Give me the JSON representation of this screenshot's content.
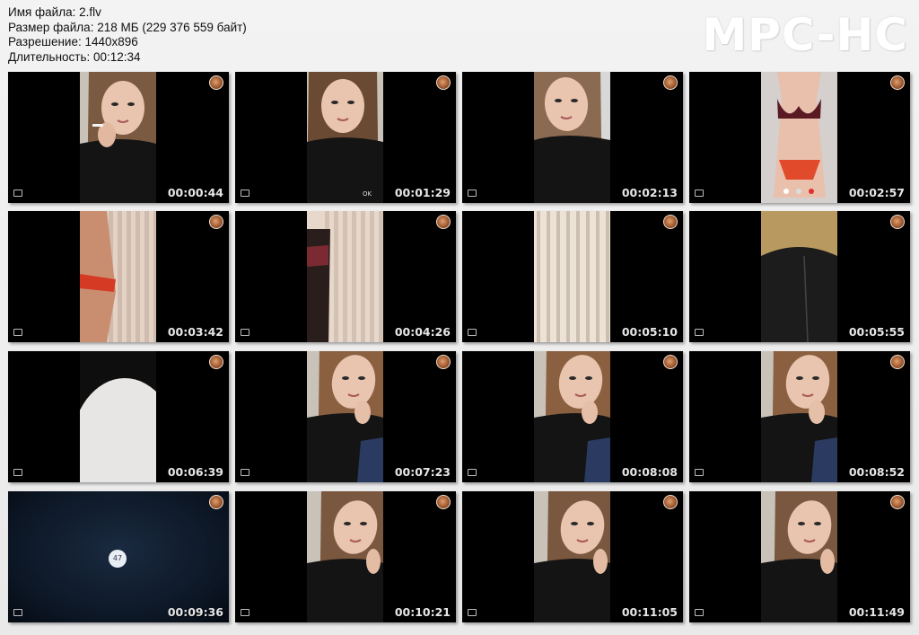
{
  "file_info": {
    "name": "Имя файла: 2.flv",
    "size": "Размер файла: 218 МБ (229 376 559 байт)",
    "resolution": "Разрешение: 1440x896",
    "duration": "Длительность: 00:12:34"
  },
  "logo": "MPC-HC",
  "thumbnails": [
    {
      "time": "00:00:44",
      "scene": "face-smoking"
    },
    {
      "time": "00:01:29",
      "scene": "face-hoodie"
    },
    {
      "time": "00:02:13",
      "scene": "face-close"
    },
    {
      "time": "00:02:57",
      "scene": "body-lingerie"
    },
    {
      "time": "00:03:42",
      "scene": "curtain-arm"
    },
    {
      "time": "00:04:26",
      "scene": "curtain-body"
    },
    {
      "time": "00:05:10",
      "scene": "curtain"
    },
    {
      "time": "00:05:55",
      "scene": "back-hoodie"
    },
    {
      "time": "00:06:39",
      "scene": "blur-white"
    },
    {
      "time": "00:07:23",
      "scene": "face-hand"
    },
    {
      "time": "00:08:08",
      "scene": "face-hand"
    },
    {
      "time": "00:08:52",
      "scene": "face-hand"
    },
    {
      "time": "00:09:36",
      "scene": "skype-call"
    },
    {
      "time": "00:10:21",
      "scene": "face-tilt"
    },
    {
      "time": "00:11:05",
      "scene": "face-tilt"
    },
    {
      "time": "00:11:49",
      "scene": "face-tilt"
    }
  ],
  "skype_call_badge": "47",
  "colors": {
    "background": "#eeeeee",
    "thumb_bg": "#000000",
    "timestamp": "#e6e6e6"
  }
}
